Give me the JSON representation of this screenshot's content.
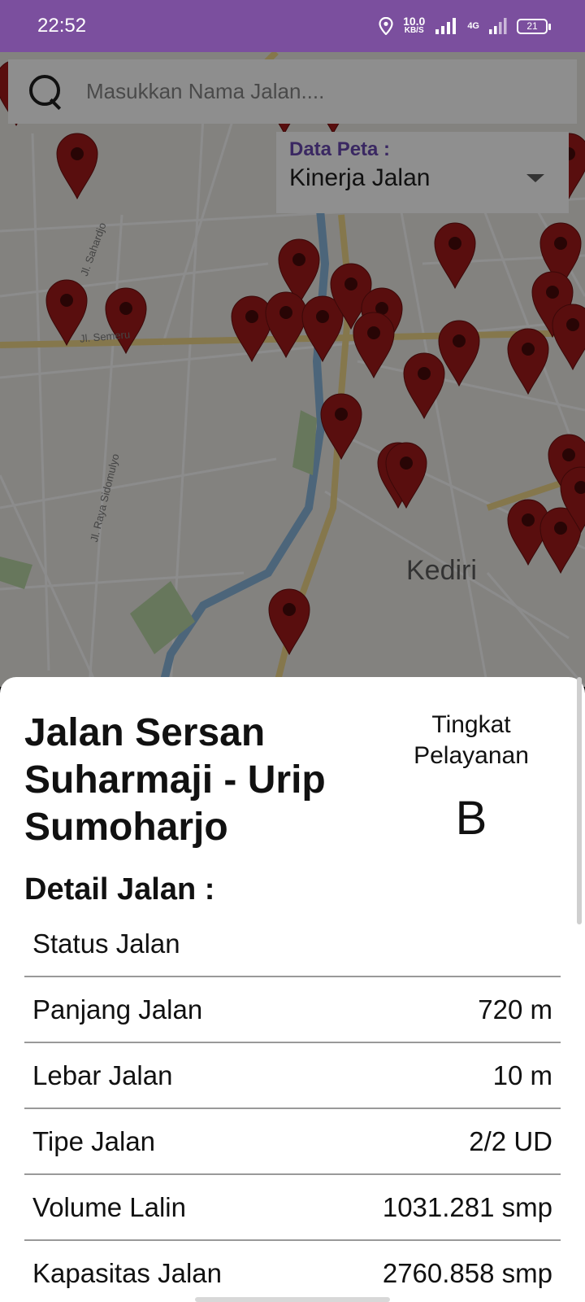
{
  "status_bar": {
    "time": "22:52",
    "net_speed_value": "10.0",
    "net_speed_unit": "KB/S",
    "network_type": "4G",
    "battery": "21"
  },
  "search": {
    "placeholder": "Masukkan Nama Jalan...."
  },
  "data_selector": {
    "label": "Data Peta :",
    "value": "Kinerja Jalan"
  },
  "map": {
    "city_label": "Kediri",
    "road_labels": [
      "Jl. Semeru",
      "Jl. Raya Sidomulyo",
      "Jl. Sahardjo"
    ]
  },
  "detail": {
    "road_name": "Jalan Sersan Suharmaji - Urip Sumoharjo",
    "los_caption": "Tingkat Pelayanan",
    "los_value": "B",
    "heading": "Detail Jalan :",
    "rows": [
      {
        "label": "Status Jalan",
        "value": ""
      },
      {
        "label": "Panjang Jalan",
        "value": "720 m"
      },
      {
        "label": "Lebar Jalan",
        "value": "10 m"
      },
      {
        "label": "Tipe Jalan",
        "value": "2/2 UD"
      },
      {
        "label": "Volume Lalin",
        "value": "1031.281 smp"
      },
      {
        "label": "Kapasitas Jalan",
        "value": "2760.858 smp"
      }
    ]
  },
  "colors": {
    "status_bar": "#7b4f9e",
    "marker": "#a31b1b",
    "accent_label": "#3a2862"
  }
}
